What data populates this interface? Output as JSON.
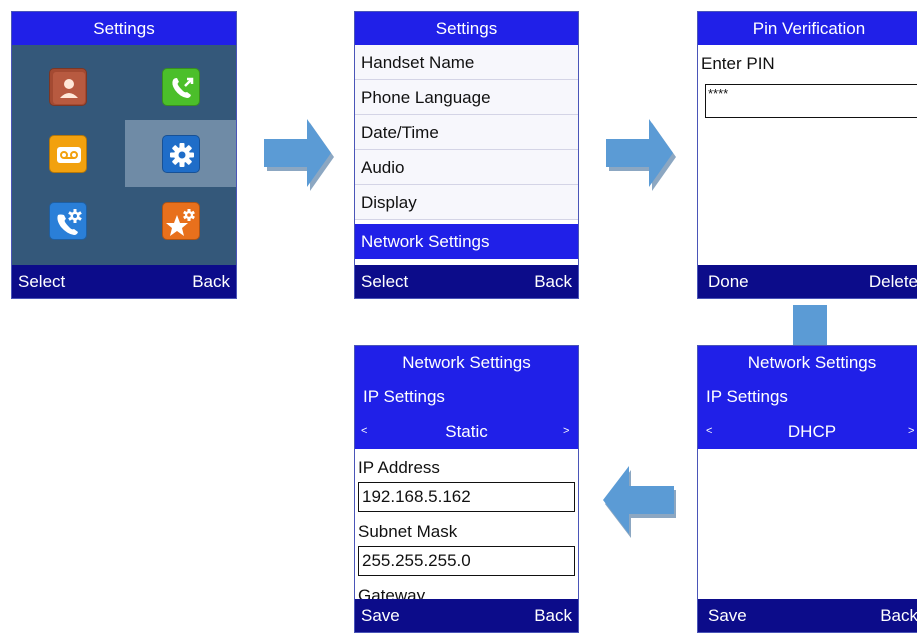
{
  "screens": {
    "home": {
      "title": "Settings",
      "soft_left": "Select",
      "soft_right": "Back",
      "apps": [
        {
          "icon": "contacts-icon",
          "color": "#a44a32"
        },
        {
          "icon": "call-history-icon",
          "color": "#4bbf2a"
        },
        {
          "icon": "voicemail-icon",
          "color": "#f2a10e"
        },
        {
          "icon": "settings-gear-icon",
          "color": "#1f6dc8",
          "selected": true
        },
        {
          "icon": "call-settings-icon",
          "color": "#2a7fd8"
        },
        {
          "icon": "features-star-icon",
          "color": "#e8701c"
        }
      ]
    },
    "settings_menu": {
      "title": "Settings",
      "items": [
        "Handset Name",
        "Phone Language",
        "Date/Time",
        "Audio",
        "Display",
        "Network Settings"
      ],
      "selected_index": 5,
      "soft_left": "Select",
      "soft_right": "Back"
    },
    "pin": {
      "title": "Pin Verification",
      "label": "Enter PIN",
      "value": "****",
      "soft_left": "Done",
      "soft_right": "Delete"
    },
    "network_dhcp": {
      "title": "Network Settings",
      "section": "IP Settings",
      "mode": "DHCP",
      "prev": "<",
      "next": ">",
      "soft_left": "Save",
      "soft_right": "Back"
    },
    "network_static": {
      "title": "Network Settings",
      "section": "IP Settings",
      "mode": "Static",
      "prev": "<",
      "next": ">",
      "ip_label": "IP Address",
      "ip_value": "192.168.5.162",
      "mask_label": "Subnet Mask",
      "mask_value": "255.255.255.0",
      "next_label": "Gateway",
      "soft_left": "Save",
      "soft_right": "Back"
    }
  },
  "colors": {
    "title_bar": "#2020e8",
    "soft_bar": "#0c0c8a",
    "arrow": "#5b9bd5",
    "grid_bg": "#34587a"
  }
}
